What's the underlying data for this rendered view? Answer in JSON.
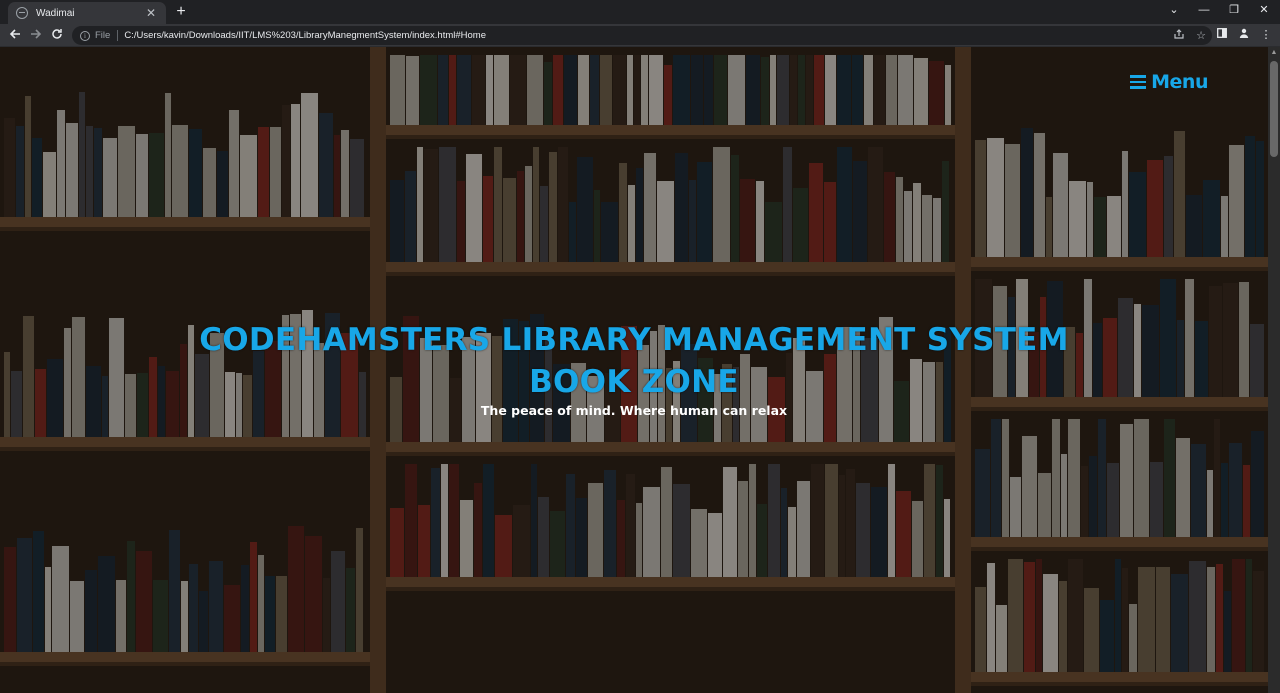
{
  "browser": {
    "tab_title": "Wadimai",
    "tab_close": "✕",
    "new_tab": "+",
    "scheme_label": "File",
    "url": "C:/Users/kavin/Downloads/IIT/LMS%203/LibraryManegmentSystem/index.html#Home",
    "icons": [
      "back-icon",
      "forward-icon",
      "reload-icon",
      "info-icon",
      "share-icon",
      "star-icon",
      "sidepanel-icon",
      "profile-icon",
      "more-icon"
    ],
    "window_controls": {
      "dropdown": "⌄",
      "minimize": "—",
      "restore": "❐",
      "close": "✕"
    }
  },
  "page": {
    "menu_label": "Menu",
    "title_line1": "CODEHAMSTERS LIBRARY MANAGEMENT SYSTEM",
    "title_line2": "BOOK ZONE",
    "tagline": "The peace of mind. Where human can relax",
    "accent_color": "#18a7e8"
  }
}
